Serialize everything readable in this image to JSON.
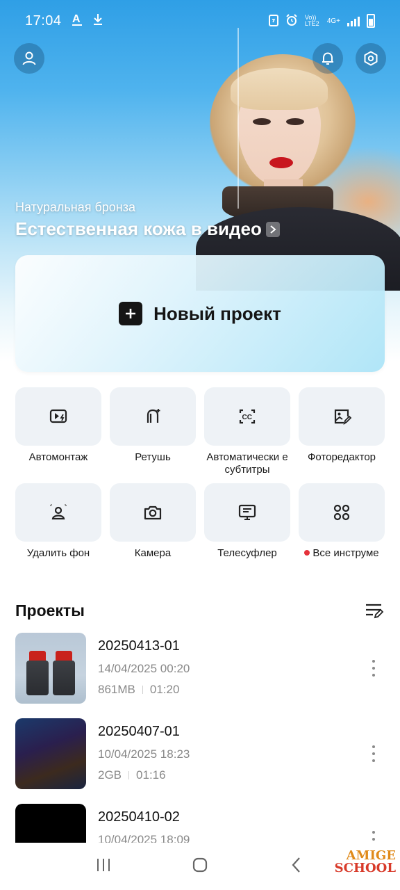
{
  "status_bar": {
    "time": "17:04",
    "left_icons": [
      "text-a-icon",
      "download-icon"
    ],
    "network_label": "Vo)) LTE2",
    "net_type": "4G+"
  },
  "header": {
    "profile_icon": "user-icon",
    "notification_icon": "bell-icon",
    "settings_icon": "gear-icon"
  },
  "hero": {
    "subtitle": "Натуральная бронза",
    "title": "Естественная кожа в видео"
  },
  "new_project": {
    "label": "Новый проект"
  },
  "tools": [
    {
      "label": "Автомонтаж",
      "icon": "auto-edit-icon"
    },
    {
      "label": "Ретушь",
      "icon": "retouch-icon"
    },
    {
      "label": "Автоматически е субтитры",
      "icon": "captions-icon"
    },
    {
      "label": "Фоторедактор",
      "icon": "photo-editor-icon"
    },
    {
      "label": "Удалить фон",
      "icon": "remove-background-icon"
    },
    {
      "label": "Камера",
      "icon": "camera-icon"
    },
    {
      "label": "Телесуфлер",
      "icon": "teleprompter-icon"
    },
    {
      "label": "Все инструме",
      "icon": "all-tools-icon"
    }
  ],
  "projects": {
    "title": "Проекты",
    "items": [
      {
        "name": "20250413-01",
        "date": "14/04/2025 00:20",
        "size": "861MB",
        "duration": "01:20"
      },
      {
        "name": "20250407-01",
        "date": "10/04/2025 18:23",
        "size": "2GB",
        "duration": "01:16"
      },
      {
        "name": "20250410-02",
        "date": "10/04/2025 18:09"
      }
    ]
  },
  "watermark": {
    "line1": "AMIGE",
    "line2": "SCHOOL"
  },
  "colors": {
    "accent_dark": "#151515",
    "tile_bg": "#eef2f6",
    "badge_red": "#e5323b"
  }
}
